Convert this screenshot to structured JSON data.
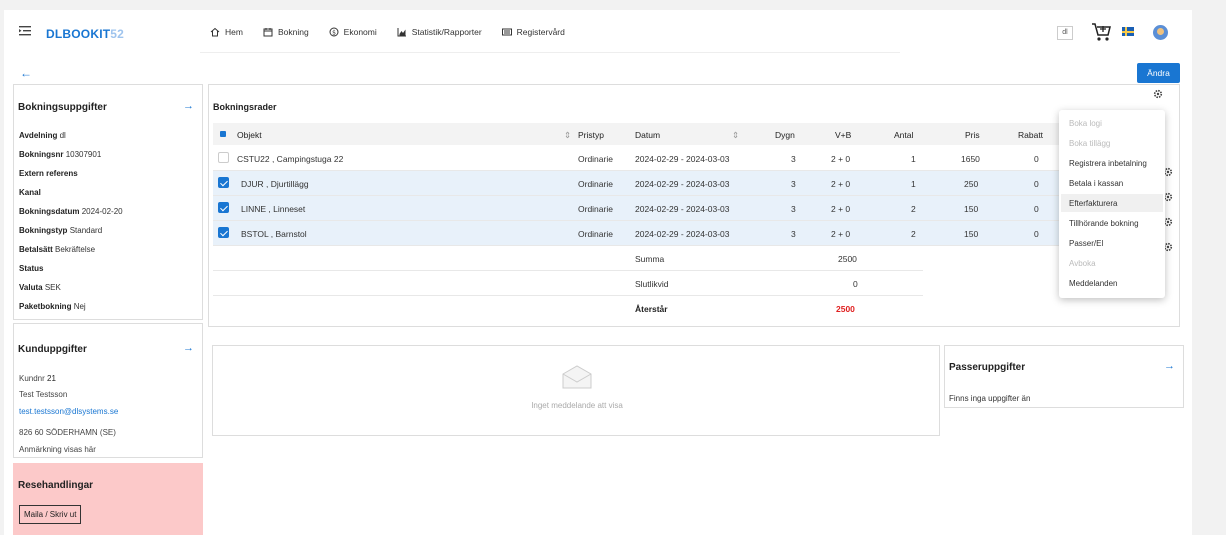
{
  "header": {
    "logo_part1": "DLBOOKIT",
    "logo_part2": "52",
    "nav": [
      "Hem",
      "Bokning",
      "Ekonomi",
      "Statistik/Rapporter",
      "Registervård"
    ],
    "lang": "dl"
  },
  "actions": {
    "edit_label": "Ändra"
  },
  "booking_details": {
    "title": "Bokningsuppgifter",
    "fields": [
      {
        "label": "Avdelning",
        "value": "dl"
      },
      {
        "label": "Bokningsnr",
        "value": "10307901"
      },
      {
        "label": "Extern referens",
        "value": ""
      },
      {
        "label": "Kanal",
        "value": ""
      },
      {
        "label": "Bokningsdatum",
        "value": "2024-02-20"
      },
      {
        "label": "Bokningstyp",
        "value": "Standard"
      },
      {
        "label": "Betalsätt",
        "value": "Bekräftelse"
      },
      {
        "label": "Status",
        "value": ""
      },
      {
        "label": "Valuta",
        "value": "SEK"
      },
      {
        "label": "Paketbokning",
        "value": "Nej"
      }
    ]
  },
  "customer": {
    "title": "Kunduppgifter",
    "customer_no_label": "Kundnr",
    "customer_no": "21",
    "name": "Test Testsson",
    "email": "test.testsson@dlsystems.se",
    "address": "826 60 SÖDERHAMN (SE)",
    "note": "Anmärkning visas här"
  },
  "travel_docs": {
    "title": "Resehandlingar",
    "button": "Maila / Skriv ut"
  },
  "booking_rows": {
    "title": "Bokningsrader",
    "columns": [
      "Objekt",
      "Pristyp",
      "Datum",
      "Dygn",
      "V+B",
      "Antal",
      "Pris",
      "Rabatt"
    ],
    "rows": [
      {
        "objekt": "CSTU22 , Campingstuga 22",
        "pristyp": "Ordinarie",
        "datum": "2024-02-29 - 2024-03-03",
        "dygn": "3",
        "vb": "2 + 0",
        "antal": "1",
        "pris": "1650",
        "rabatt": "0",
        "selected": false
      },
      {
        "objekt": "DJUR , Djurtillägg",
        "pristyp": "Ordinarie",
        "datum": "2024-02-29 - 2024-03-03",
        "dygn": "3",
        "vb": "2 + 0",
        "antal": "1",
        "pris": "250",
        "rabatt": "0",
        "selected": true
      },
      {
        "objekt": "LINNE , Linneset",
        "pristyp": "Ordinarie",
        "datum": "2024-02-29 - 2024-03-03",
        "dygn": "3",
        "vb": "2 + 0",
        "antal": "2",
        "pris": "150",
        "rabatt": "0",
        "selected": true
      },
      {
        "objekt": "BSTOL , Barnstol",
        "pristyp": "Ordinarie",
        "datum": "2024-02-29 - 2024-03-03",
        "dygn": "3",
        "vb": "2 + 0",
        "antal": "2",
        "pris": "150",
        "rabatt": "0",
        "selected": true
      }
    ],
    "summary": {
      "sum_label": "Summa",
      "sum_value": "2500",
      "final_label": "Slutlikvid",
      "final_value": "0",
      "remaining_label": "Återstår",
      "remaining_value": "2500"
    }
  },
  "context_menu": {
    "items": [
      {
        "label": "Boka logi",
        "disabled": true
      },
      {
        "label": "Boka tillägg",
        "disabled": true
      },
      {
        "label": "Registrera inbetalning",
        "disabled": false
      },
      {
        "label": "Betala i kassan",
        "disabled": false
      },
      {
        "label": "Efterfakturera",
        "disabled": false,
        "highlighted": true
      },
      {
        "label": "Tillhörande bokning",
        "disabled": false
      },
      {
        "label": "Passer/El",
        "disabled": false
      },
      {
        "label": "Avboka",
        "disabled": true
      },
      {
        "label": "Meddelanden",
        "disabled": false
      }
    ]
  },
  "messages": {
    "empty_text": "Inget meddelande att visa"
  },
  "passenger": {
    "title": "Passeruppgifter",
    "empty_text": "Finns inga uppgifter än"
  },
  "colors": {
    "accent": "#1976d2",
    "danger": "#e02020",
    "docs_bg": "#fcc9c9",
    "selected_row": "#e8f1fa"
  },
  "icons": [
    "menu-icon",
    "home-icon",
    "calendar-icon",
    "money-icon",
    "chart-icon",
    "register-icon",
    "cart-icon",
    "flag-icon",
    "avatar-icon",
    "back-arrow-icon",
    "forward-arrow-icon",
    "gear-icon",
    "envelope-icon",
    "sort-icon"
  ]
}
